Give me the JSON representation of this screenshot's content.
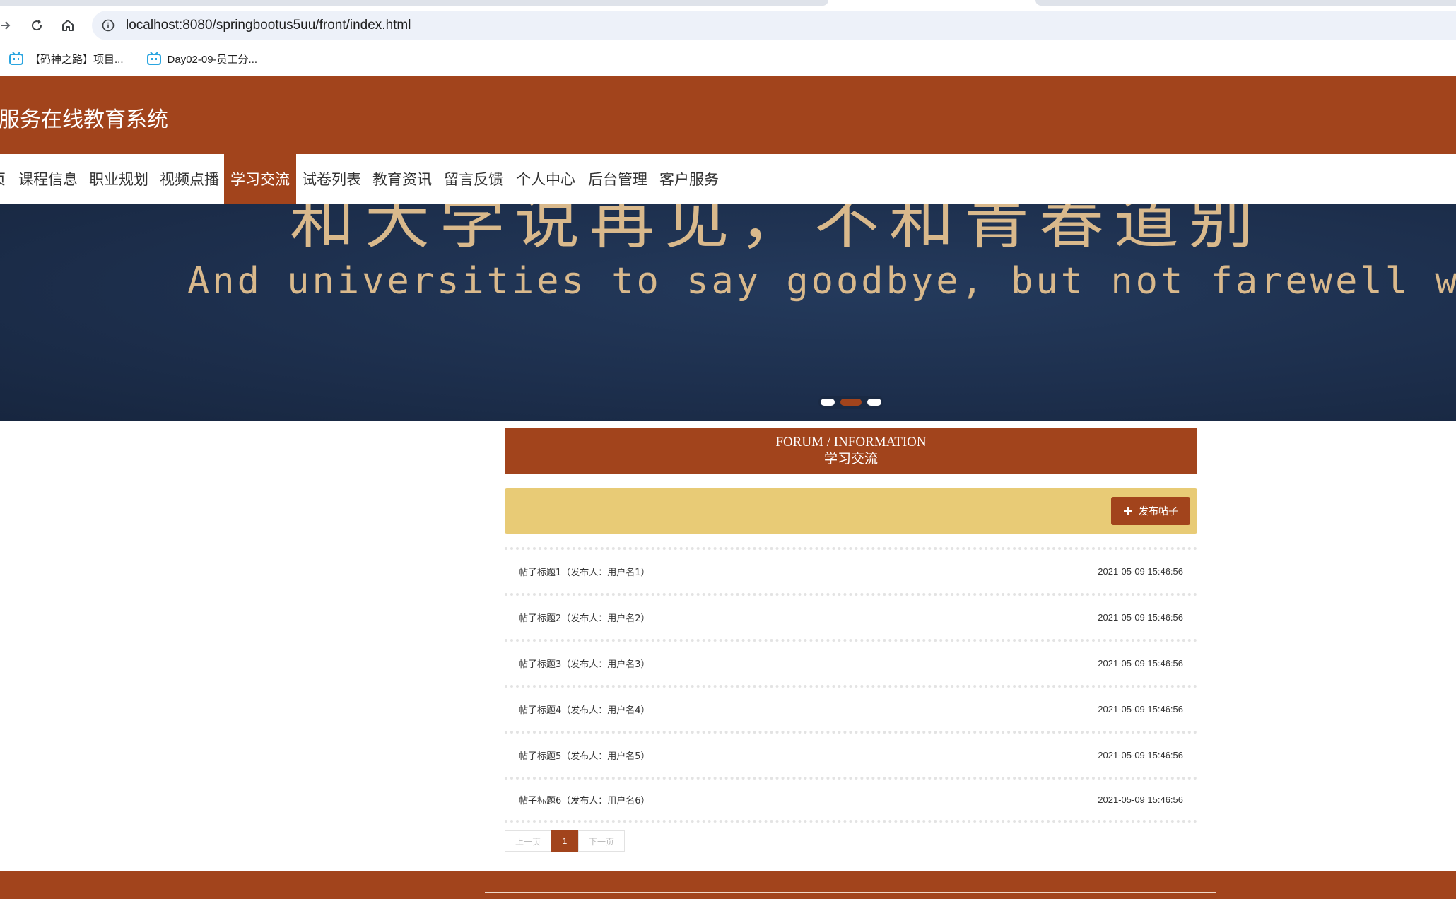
{
  "browser": {
    "url": "localhost:8080/springbootus5uu/front/index.html",
    "bookmarks": [
      {
        "label": "【码神之路】项目..."
      },
      {
        "label": "Day02-09-员工分..."
      }
    ]
  },
  "site": {
    "title": "服务在线教育系统",
    "nav": [
      {
        "label": "页"
      },
      {
        "label": "课程信息"
      },
      {
        "label": "职业规划"
      },
      {
        "label": "视频点播"
      },
      {
        "label": "学习交流"
      },
      {
        "label": "试卷列表"
      },
      {
        "label": "教育资讯"
      },
      {
        "label": "留言反馈"
      },
      {
        "label": "个人中心"
      },
      {
        "label": "后台管理"
      },
      {
        "label": "客户服务"
      }
    ],
    "active_nav": "学习交流"
  },
  "banner": {
    "line_cn": "和大学说再见，不和青春道别",
    "line_en": "And universities to say goodbye, but not farewell with youth",
    "slide_count": 3,
    "active_slide": 2
  },
  "forum": {
    "heading_en": "FORUM / INFORMATION",
    "heading_cn": "学习交流",
    "post_button": "发布帖子",
    "posts": [
      {
        "title": "帖子标题1（发布人：用户名1）",
        "time": "2021-05-09 15:46:56"
      },
      {
        "title": "帖子标题2（发布人：用户名2）",
        "time": "2021-05-09 15:46:56"
      },
      {
        "title": "帖子标题3（发布人：用户名3）",
        "time": "2021-05-09 15:46:56"
      },
      {
        "title": "帖子标题4（发布人：用户名4）",
        "time": "2021-05-09 15:46:56"
      },
      {
        "title": "帖子标题5（发布人：用户名5）",
        "time": "2021-05-09 15:46:56"
      },
      {
        "title": "帖子标题6（发布人：用户名6）",
        "time": "2021-05-09 15:46:56"
      }
    ],
    "pager": {
      "prev": "上一页",
      "current": "1",
      "next": "下一页"
    }
  },
  "colors": {
    "brand": "#a2441c",
    "action_bar": "#e8cb76",
    "banner_bg": "#1d2f4d",
    "banner_text": "#d9b98c"
  },
  "icons": {
    "back": "arrow-right-icon",
    "reload": "reload-icon",
    "home": "home-icon",
    "site_info": "info-icon",
    "bookmark": "bilibili-icon",
    "add": "plus-icon"
  }
}
